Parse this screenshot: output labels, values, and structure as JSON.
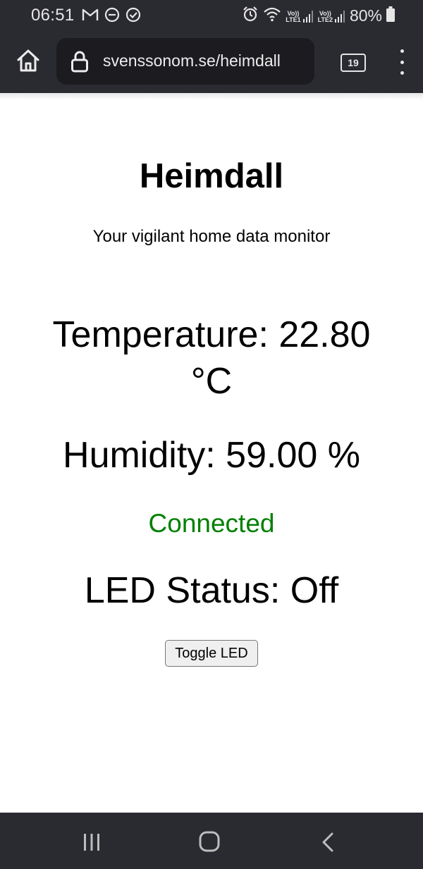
{
  "status_bar": {
    "time": "06:51",
    "left_icons": [
      "gmail-icon",
      "do-not-disturb-icon",
      "check-circle-icon"
    ],
    "right_icons": [
      "alarm-icon",
      "wifi-icon",
      "signal-lte1-icon",
      "signal-lte2-icon",
      "battery-icon"
    ],
    "sim1_label_top": "Vo))",
    "sim1_label_bottom": "LTE1",
    "sim2_label_top": "Vo))",
    "sim2_label_bottom": "LTE2",
    "battery": "80%"
  },
  "browser": {
    "url": "svenssonom.se/heimdall",
    "tab_count": "19",
    "icons": [
      "home-icon",
      "lock-icon",
      "tabs-icon",
      "menu-icon"
    ]
  },
  "page": {
    "title": "Heimdall",
    "subtitle": "Your vigilant home data monitor",
    "temperature_text": "Temperature: 22.80 °C",
    "humidity_text": "Humidity: 59.00 %",
    "connection_text": "Connected",
    "led_status_text": "LED Status: Off",
    "toggle_button_label": "Toggle LED"
  },
  "colors": {
    "system_bar": "#2a2a31",
    "address_box": "#1b1b20",
    "connected": "#008000",
    "text": "#000000"
  },
  "nav_bar": {
    "icons": [
      "recents-icon",
      "home-circle-icon",
      "back-icon"
    ]
  }
}
